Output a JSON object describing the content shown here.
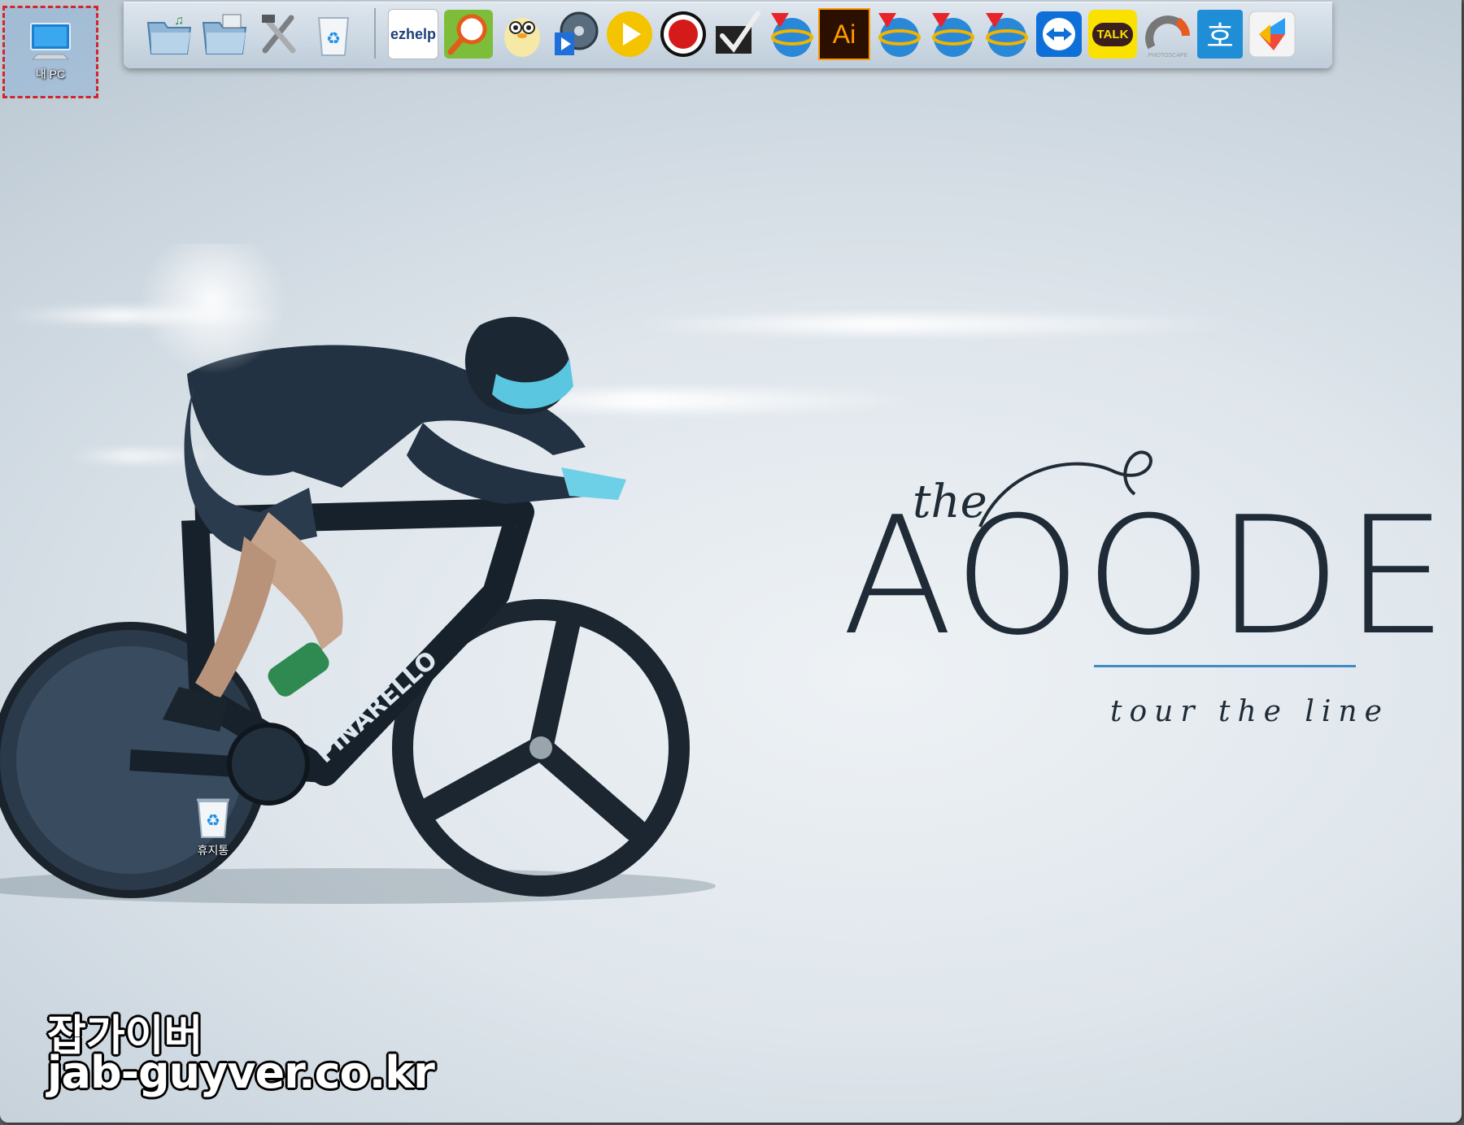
{
  "desktop": {
    "icons": [
      {
        "name": "my-pc",
        "label": "내 PC"
      },
      {
        "name": "recycle-bin",
        "label": "휴지통"
      }
    ]
  },
  "dock": {
    "items": [
      {
        "name": "music-folder-icon"
      },
      {
        "name": "images-folder-icon"
      },
      {
        "name": "tools-icon"
      },
      {
        "name": "dock-recycle-bin-icon"
      },
      {
        "name": "ezhelp-icon",
        "text": "ezhelp"
      },
      {
        "name": "search-app-icon"
      },
      {
        "name": "penguin-app-icon"
      },
      {
        "name": "video-editor-icon"
      },
      {
        "name": "play-button-app-icon"
      },
      {
        "name": "record-app-icon"
      },
      {
        "name": "checkmark-app-icon"
      },
      {
        "name": "globe-download-icon"
      },
      {
        "name": "illustrator-icon",
        "text": "Ai"
      },
      {
        "name": "globe-download-icon-2"
      },
      {
        "name": "globe-download-icon-3"
      },
      {
        "name": "globe-download-icon-4"
      },
      {
        "name": "teamviewer-icon"
      },
      {
        "name": "kakaotalk-icon",
        "text": "TALK"
      },
      {
        "name": "photoscape-icon",
        "text": "PHOTOSCAPE"
      },
      {
        "name": "hangul-icon",
        "text": "호"
      },
      {
        "name": "app-launcher-icon"
      }
    ]
  },
  "wallpaper": {
    "brand_the": "the",
    "brand_main": "AOODEM",
    "tagline": "tour the line"
  },
  "watermark": {
    "line1": "잡가이버",
    "line2": "jab-guyver.co.kr"
  },
  "colors": {
    "accent_line": "#3f8bc4",
    "selection_outline": "#d1262b",
    "kakao_yellow": "#fae100",
    "ai_orange": "#ff9a00"
  }
}
